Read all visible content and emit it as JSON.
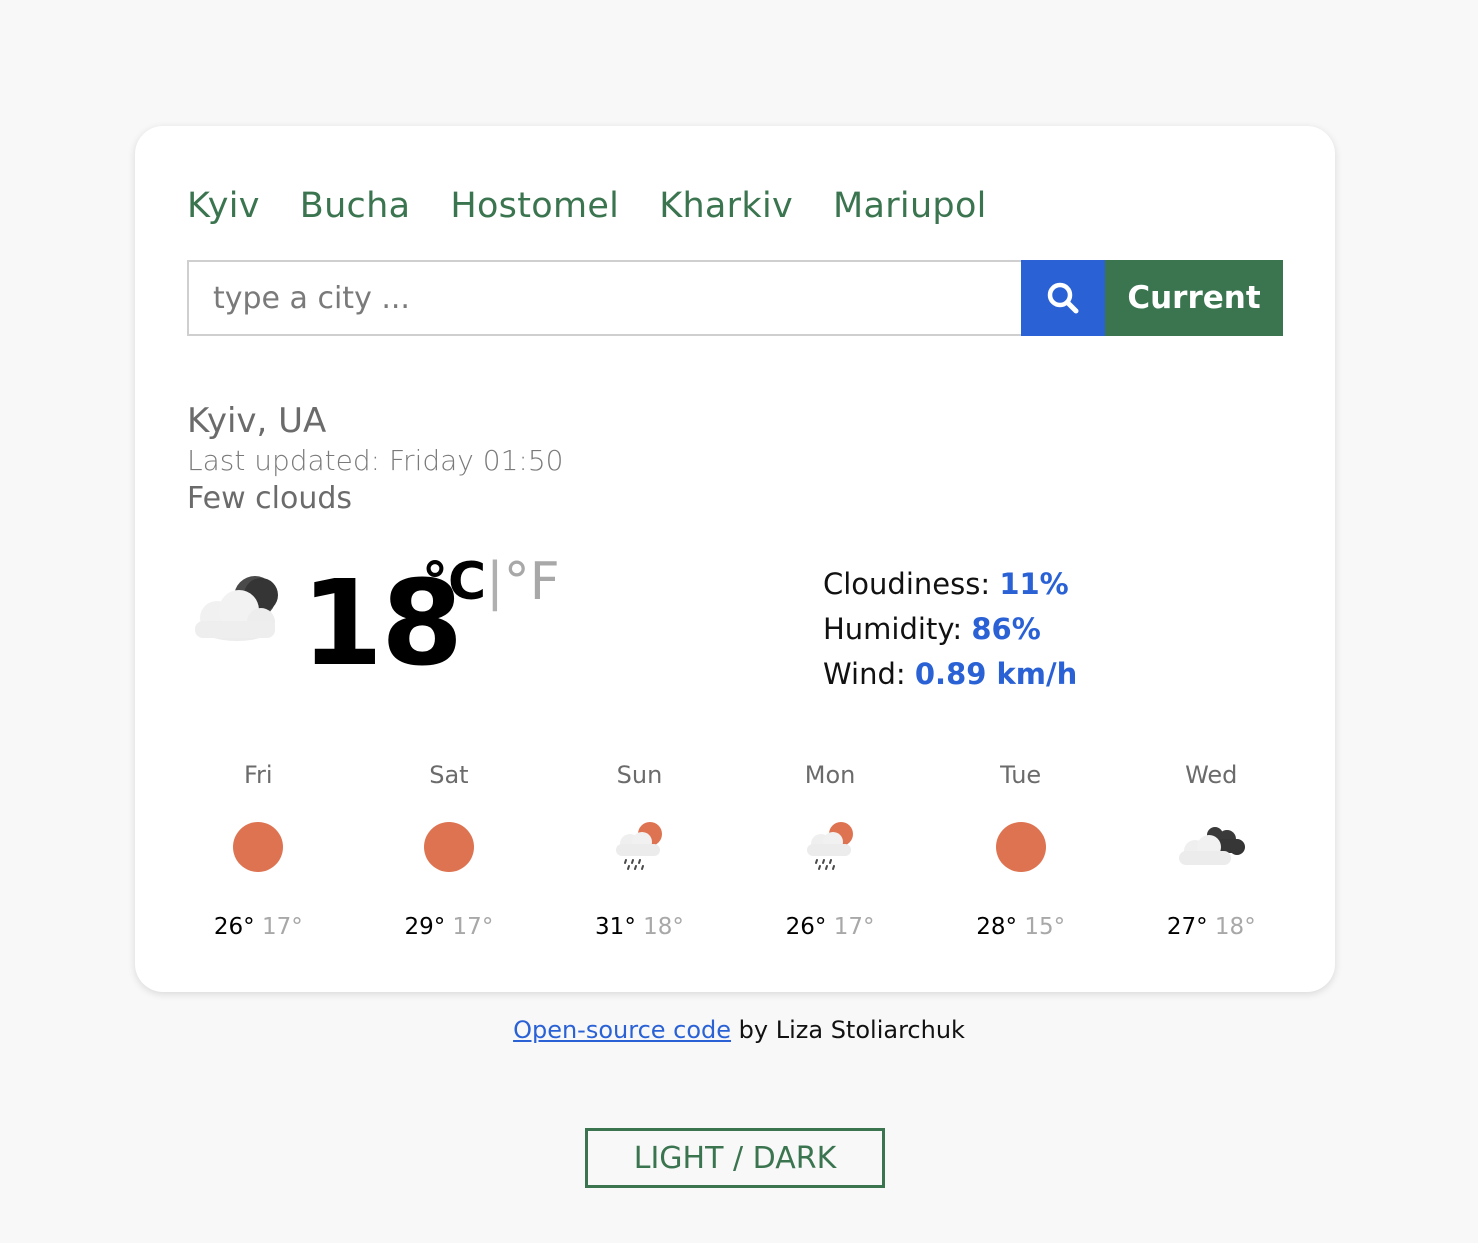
{
  "cities": [
    "Kyiv",
    "Bucha",
    "Hostomel",
    "Kharkiv",
    "Mariupol"
  ],
  "search": {
    "placeholder": "type a city ...",
    "search_icon": "search-icon",
    "current_label": "Current"
  },
  "weather": {
    "location": "Kyiv, UA",
    "last_updated": "Last updated: Friday 01:50",
    "description": "Few clouds",
    "icon": "few-clouds-night-icon",
    "temperature": "18",
    "unit_c": "°C",
    "unit_sep": "|",
    "unit_f": "°F",
    "cloudiness_label": "Cloudiness: ",
    "cloudiness": "11%",
    "humidity_label": "Humidity: ",
    "humidity": "86%",
    "wind_label": "Wind: ",
    "wind": "0.89 km/h"
  },
  "forecast": [
    {
      "day": "Fri",
      "icon": "sun-icon",
      "max": "26°",
      "min": "17°"
    },
    {
      "day": "Sat",
      "icon": "sun-icon",
      "max": "29°",
      "min": "17°"
    },
    {
      "day": "Sun",
      "icon": "sun-rain-icon",
      "max": "31°",
      "min": "18°"
    },
    {
      "day": "Mon",
      "icon": "sun-rain-icon",
      "max": "26°",
      "min": "17°"
    },
    {
      "day": "Tue",
      "icon": "sun-icon",
      "max": "28°",
      "min": "15°"
    },
    {
      "day": "Wed",
      "icon": "broken-clouds-icon",
      "max": "27°",
      "min": "18°"
    }
  ],
  "footer": {
    "link_text": "Open-source code",
    "by_text": " by Liza Stoliarchuk"
  },
  "theme_toggle": "LIGHT / DARK",
  "colors": {
    "accent_green": "#3b7550",
    "accent_blue": "#2a62d6",
    "sun": "#de7351",
    "background": "#f8f8f8"
  }
}
